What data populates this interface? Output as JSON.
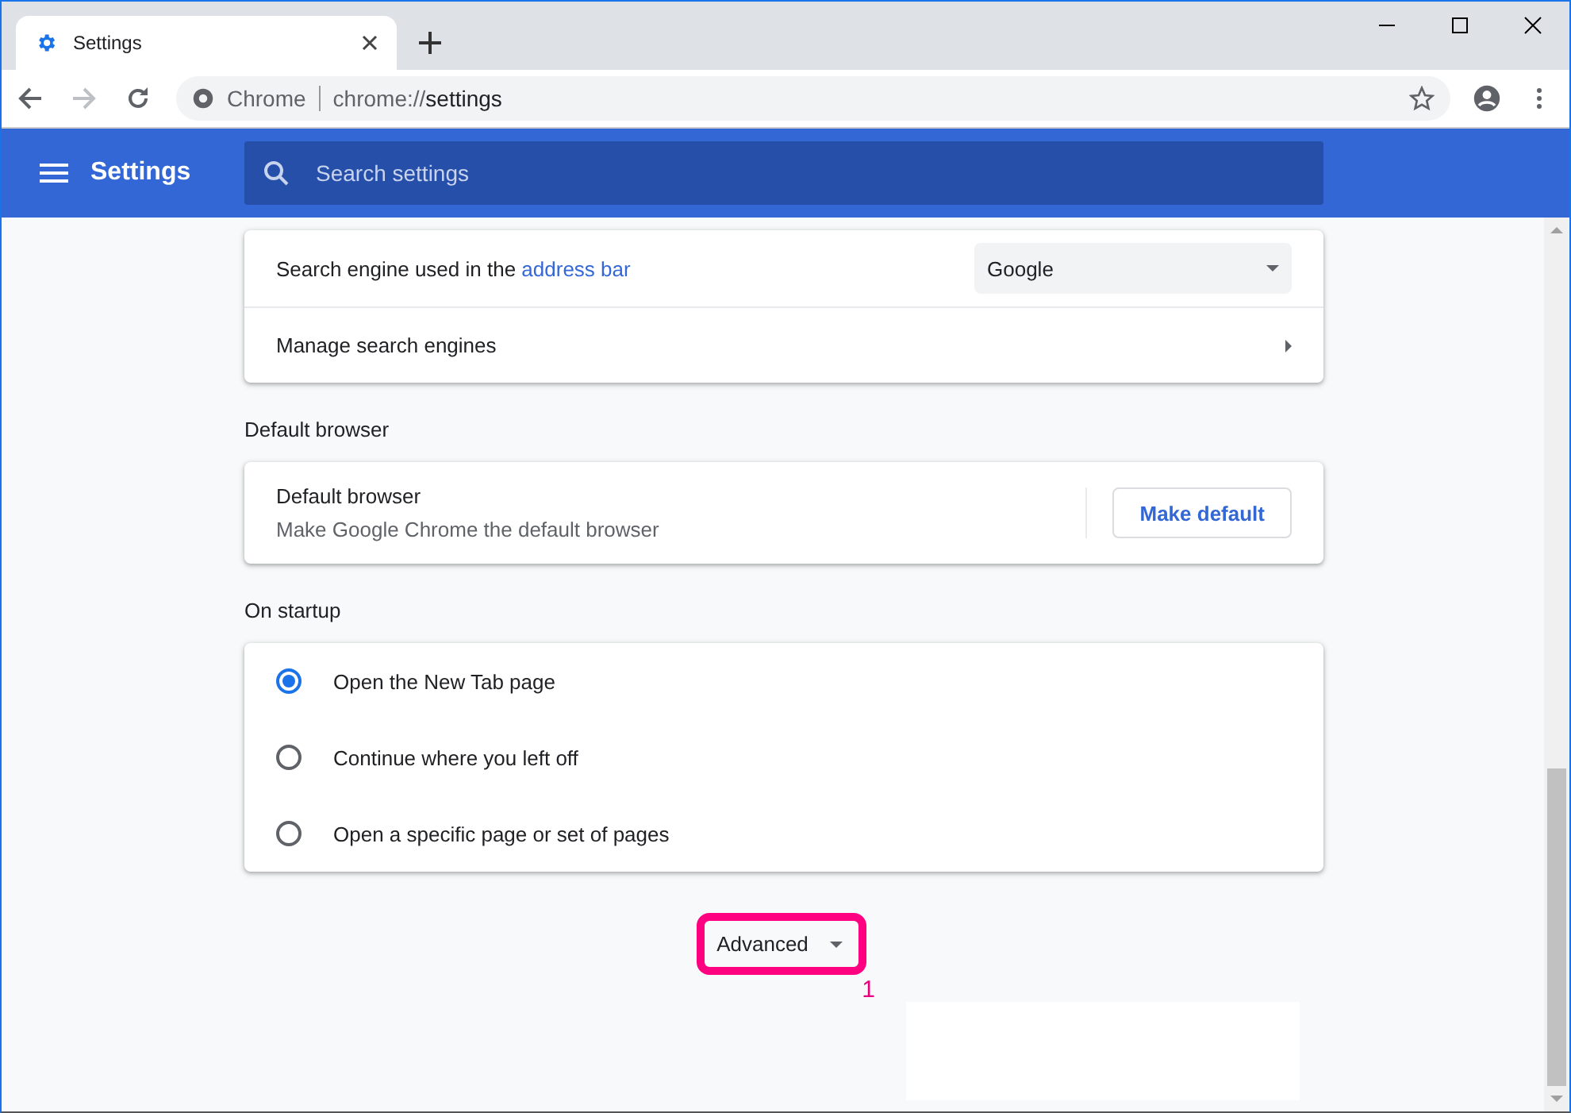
{
  "tab": {
    "title": "Settings"
  },
  "address_bar": {
    "site": "Chrome",
    "url_scheme": "chrome://",
    "url_path": "settings"
  },
  "header": {
    "title": "Settings",
    "search": {
      "placeholder": "Search settings"
    }
  },
  "search_engine_card": {
    "row_label_start": "Search engine used in the ",
    "row_label_link": "address bar",
    "dropdown_value": "Google",
    "manage_label": "Manage search engines"
  },
  "default_browser": {
    "heading": "Default browser",
    "title": "Default browser",
    "subtitle": "Make Google Chrome the default browser",
    "button": "Make default"
  },
  "on_startup": {
    "heading": "On startup",
    "options": [
      {
        "label": "Open the New Tab page",
        "selected": true
      },
      {
        "label": "Continue where you left off",
        "selected": false
      },
      {
        "label": "Open a specific page or set of pages",
        "selected": false
      }
    ]
  },
  "advanced": {
    "label": "Advanced",
    "callout": "1"
  }
}
